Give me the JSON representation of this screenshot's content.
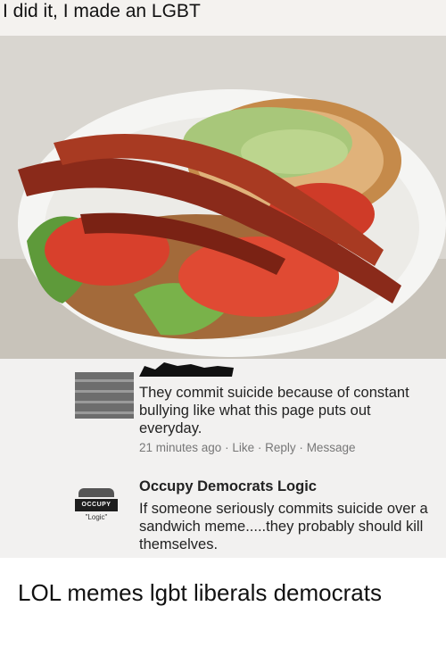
{
  "meme": {
    "caption": "I did it, I made an LGBT",
    "photo_description": "sandwich with lettuce, guacamole, bacon and tomato",
    "comment1": {
      "text": "They commit suicide because of constant bullying like what this page puts out everyday.",
      "time": "21 minutes ago",
      "like": "Like",
      "reply": "Reply",
      "message": "Message",
      "separator": "·"
    },
    "comment2": {
      "thumb_label": "OCCUPY",
      "thumb_caption": "\"Logic\"",
      "author": "Occupy Democrats Logic",
      "text": "If someone seriously commits suicide over a sandwich meme.....they probably should kill themselves."
    }
  },
  "tags": "LOL memes lgbt liberals democrats"
}
